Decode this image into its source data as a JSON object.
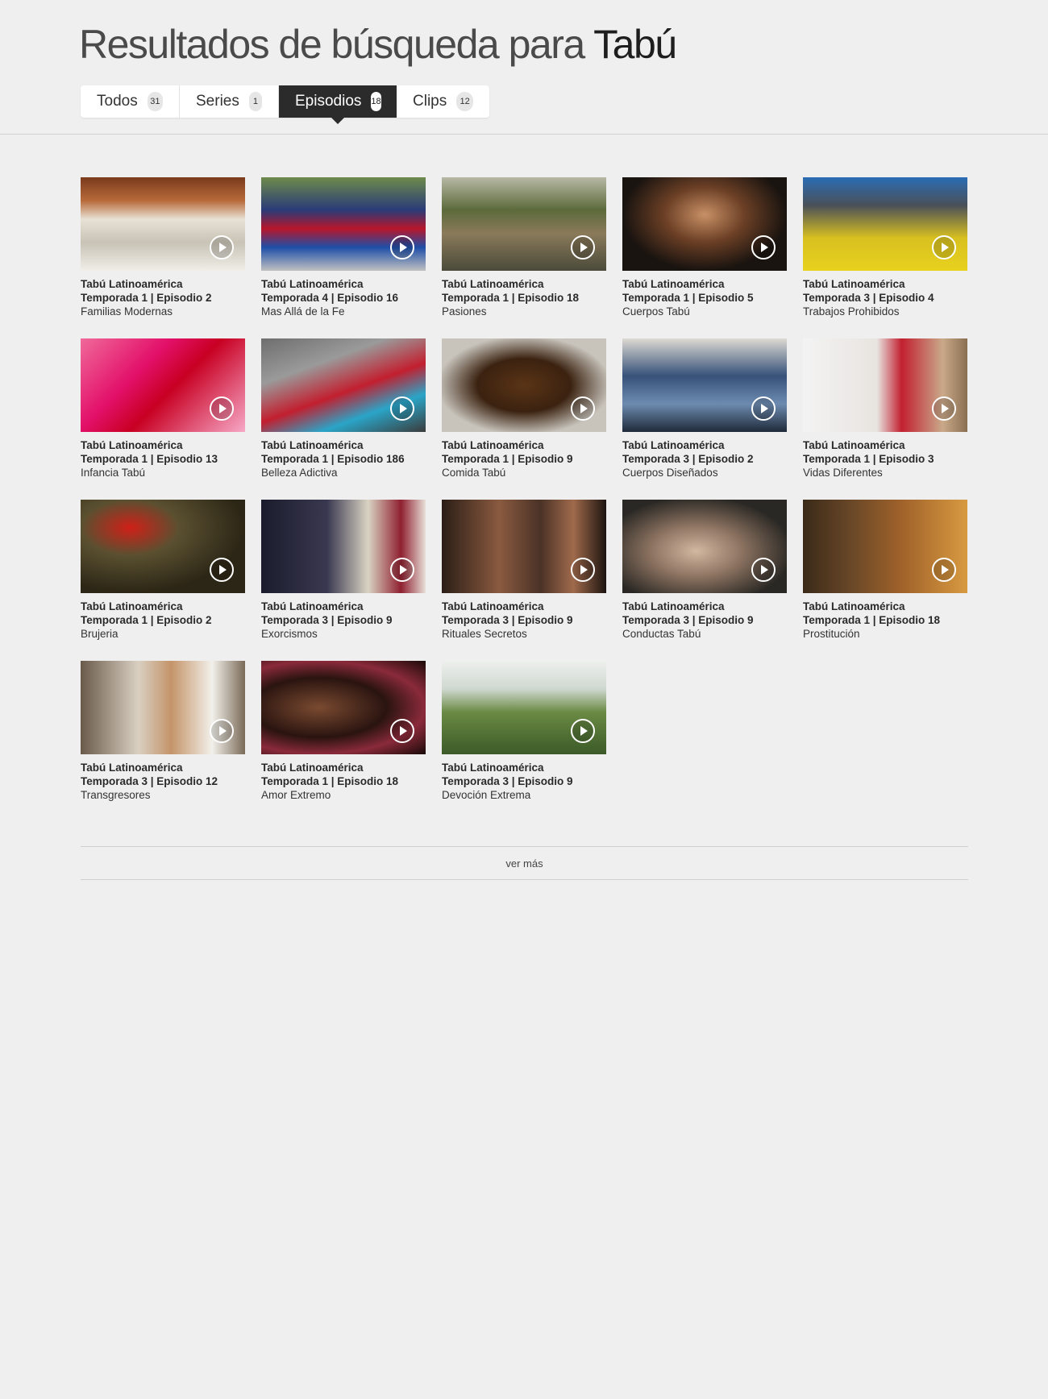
{
  "header": {
    "title_prefix": "Resultados de búsqueda para",
    "query": "Tabú"
  },
  "tabs": [
    {
      "label": "Todos",
      "count": "31",
      "active": false
    },
    {
      "label": "Series",
      "count": "1",
      "active": false
    },
    {
      "label": "Episodios",
      "count": "18",
      "active": true
    },
    {
      "label": "Clips",
      "count": "12",
      "active": false
    }
  ],
  "results": [
    {
      "series": "Tabú Latinoamérica",
      "episode": "Temporada 1 | Episodio 2",
      "name": "Familias Modernas"
    },
    {
      "series": "Tabú Latinoamérica",
      "episode": "Temporada 4 | Episodio 16",
      "name": "Mas Allá de la Fe"
    },
    {
      "series": "Tabú Latinoamérica",
      "episode": "Temporada 1 | Episodio 18",
      "name": "Pasiones"
    },
    {
      "series": "Tabú Latinoamérica",
      "episode": "Temporada 1 | Episodio 5",
      "name": "Cuerpos Tabú"
    },
    {
      "series": "Tabú Latinoamérica",
      "episode": "Temporada 3 | Episodio 4",
      "name": "Trabajos Prohibidos"
    },
    {
      "series": "Tabú Latinoamérica",
      "episode": "Temporada 1 | Episodio 13",
      "name": "Infancia Tabú"
    },
    {
      "series": "Tabú Latinoamérica",
      "episode": "Temporada 1 | Episodio 186",
      "name": "Belleza Adictiva"
    },
    {
      "series": "Tabú Latinoamérica",
      "episode": "Temporada 1 | Episodio 9",
      "name": "Comida Tabú"
    },
    {
      "series": "Tabú Latinoamérica",
      "episode": "Temporada 3 | Episodio 2",
      "name": "Cuerpos Diseñados"
    },
    {
      "series": "Tabú Latinoamérica",
      "episode": "Temporada 1 | Episodio 3",
      "name": "Vidas Diferentes"
    },
    {
      "series": "Tabú Latinoamérica",
      "episode": "Temporada 1 | Episodio 2",
      "name": "Brujeria"
    },
    {
      "series": "Tabú Latinoamérica",
      "episode": "Temporada 3 | Episodio 9",
      "name": "Exorcismos"
    },
    {
      "series": "Tabú Latinoamérica",
      "episode": "Temporada 3 | Episodio 9",
      "name": "Rituales Secretos"
    },
    {
      "series": "Tabú Latinoamérica",
      "episode": "Temporada 3 | Episodio 9",
      "name": "Conductas Tabú"
    },
    {
      "series": "Tabú Latinoamérica",
      "episode": "Temporada 1 | Episodio 18",
      "name": "Prostitución"
    },
    {
      "series": "Tabú Latinoamérica",
      "episode": "Temporada 3 | Episodio 12",
      "name": "Transgresores"
    },
    {
      "series": "Tabú Latinoamérica",
      "episode": "Temporada 1 | Episodio 18",
      "name": "Amor Extremo"
    },
    {
      "series": "Tabú Latinoamérica",
      "episode": "Temporada 3 | Episodio 9",
      "name": "Devoción Extrema"
    }
  ],
  "load_more": "ver más",
  "icons": {
    "play": "play-circle-icon"
  }
}
